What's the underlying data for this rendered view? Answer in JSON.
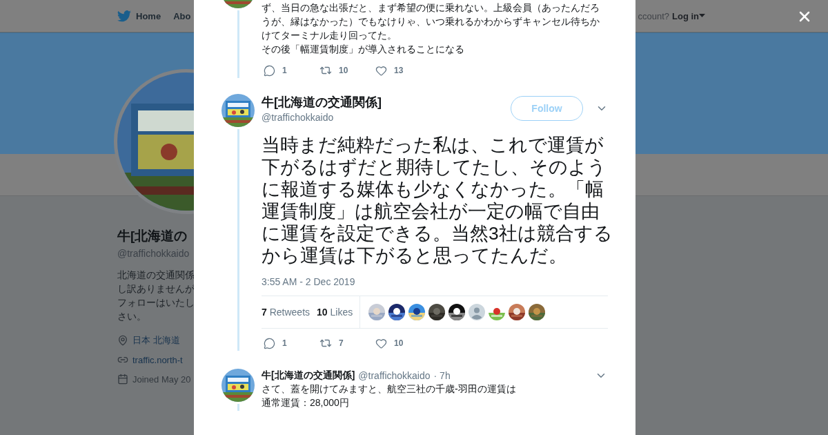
{
  "header": {
    "nav": [
      {
        "label": "Home"
      },
      {
        "label": "Abo"
      }
    ],
    "account_prompt": "ccount?",
    "login": "Log in"
  },
  "profile": {
    "name": "牛[北海道の",
    "handle": "@traffichokkaido",
    "bio_lines": [
      "北海道の交通関係",
      "し訳ありませんが",
      "フォローはいたし",
      "さい。"
    ],
    "location": "日本 北海道",
    "link": "traffic.north-t",
    "joined": "Joined May 20"
  },
  "previous_tweet": {
    "paragraphs": [
      "ず、当日の急な出張だと、まず希望の便に乗れない。上級会員（あったんだろうが、縁はなかった）でもなけりゃ、いつ乗れるかわからずキャンセル待ちかけてターミナル走り回ってた。",
      "その後「幅運賃制度」が導入されることになる"
    ],
    "replies": "1",
    "retweets": "10",
    "likes": "13"
  },
  "main_tweet": {
    "name": "牛[北海道の交通関係]",
    "handle": "@traffichokkaido",
    "follow": "Follow",
    "text": "当時まだ純粋だった私は、これで運賃が下がるはずだと期待してたし、そのように報道する媒体も少なくなかった。「幅運賃制度」は航空会社が一定の幅で自由に運賃を設定できる。当然3社は競合するから運賃は下がると思ってたんだ。",
    "time": "3:55 AM - 2 Dec 2019",
    "stats": [
      {
        "count": "7",
        "label": "Retweets"
      },
      {
        "count": "10",
        "label": "Likes"
      }
    ],
    "likers": [
      {
        "kind": "picture"
      },
      {
        "kind": "picture"
      },
      {
        "kind": "picture"
      },
      {
        "kind": "picture"
      },
      {
        "kind": "picture"
      },
      {
        "kind": "default"
      },
      {
        "kind": "picture"
      },
      {
        "kind": "picture"
      },
      {
        "kind": "picture"
      }
    ],
    "replies": "1",
    "retweets": "7",
    "likes": "10"
  },
  "reply_tweet": {
    "name": "牛[北海道の交通関係]",
    "handle": "@traffichokkaido",
    "time": "· 7h",
    "lines": [
      "さて、蓋を開けてみますと、航空三社の千歳-羽田の運賃は",
      "通常運賃：28,000円"
    ]
  }
}
